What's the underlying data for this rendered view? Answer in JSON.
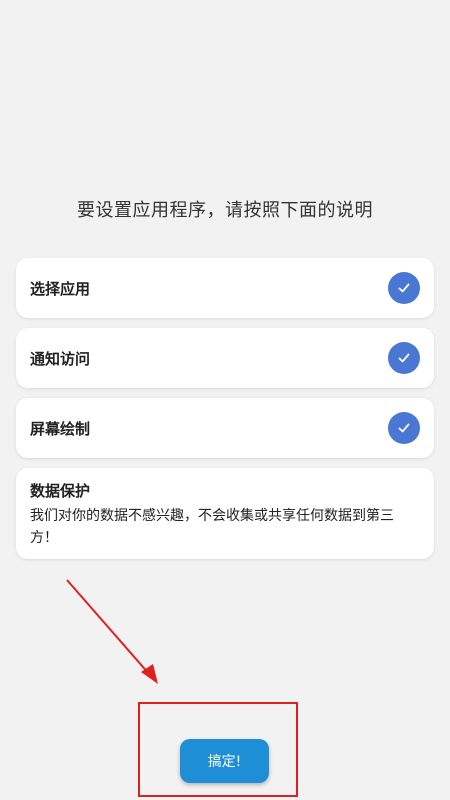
{
  "headline": "要设置应用程序，请按照下面的说明",
  "steps": [
    {
      "label": "选择应用",
      "icon": "check-icon",
      "completed": true
    },
    {
      "label": "通知访问",
      "icon": "check-icon",
      "completed": true
    },
    {
      "label": "屏幕绘制",
      "icon": "check-icon",
      "completed": true
    }
  ],
  "privacy": {
    "title": "数据保护",
    "text": "我们对你的数据不感兴趣，不会收集或共享任何数据到第三方！"
  },
  "done_button": {
    "label": "搞定!"
  },
  "colors": {
    "background": "#f2f2f2",
    "card": "#ffffff",
    "check_circle": "#4a77d4",
    "button": "#1e8fd6",
    "annotation": "#e02020"
  }
}
